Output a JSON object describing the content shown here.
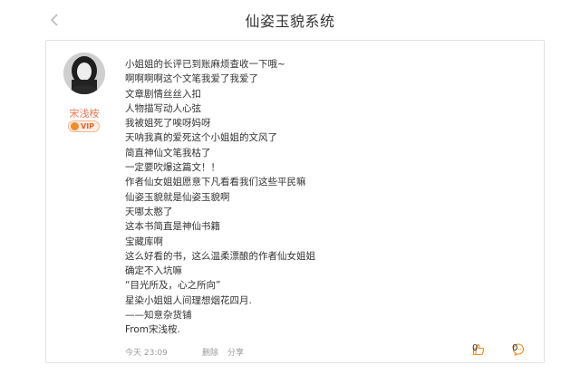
{
  "header": {
    "title": "仙姿玉貌系统"
  },
  "post": {
    "username": "宋浅桉",
    "vip_label": "VIP",
    "lines": [
      "小姐姐的长评已到账麻烦查收一下哦~",
      "啊啊啊啊这个文笔我爱了我爱了",
      "文章剧情丝丝入扣",
      "人物描写动人心弦",
      "我被姐死了唉呀妈呀",
      "天呐我真的爱死这个小姐姐的文风了",
      "简直神仙文笔我枯了",
      "一定要吹爆这篇文！！",
      "作者仙女姐姐愿意下凡看看我们这些平民嘛",
      "仙姿玉貌就是仙姿玉貌啊",
      "天哪太憨了",
      "这本书简直是神仙书籍",
      "宝藏库啊",
      "这么好看的书，这么温柔漂酿的作者仙女姐姐",
      "确定不入坑嘛",
      "“目光所及，心之所向”",
      "星染小姐姐人间理想烟花四月.",
      "——知意杂货铺",
      "From宋浅桉."
    ],
    "footer": {
      "time": "今天 23:09",
      "delete": "删除",
      "share": "分享",
      "like_count": "0",
      "comment_count": "0"
    }
  },
  "colors": {
    "username": "#eb7350",
    "meta_text": "#999999",
    "card_border": "#e2e2e2"
  }
}
